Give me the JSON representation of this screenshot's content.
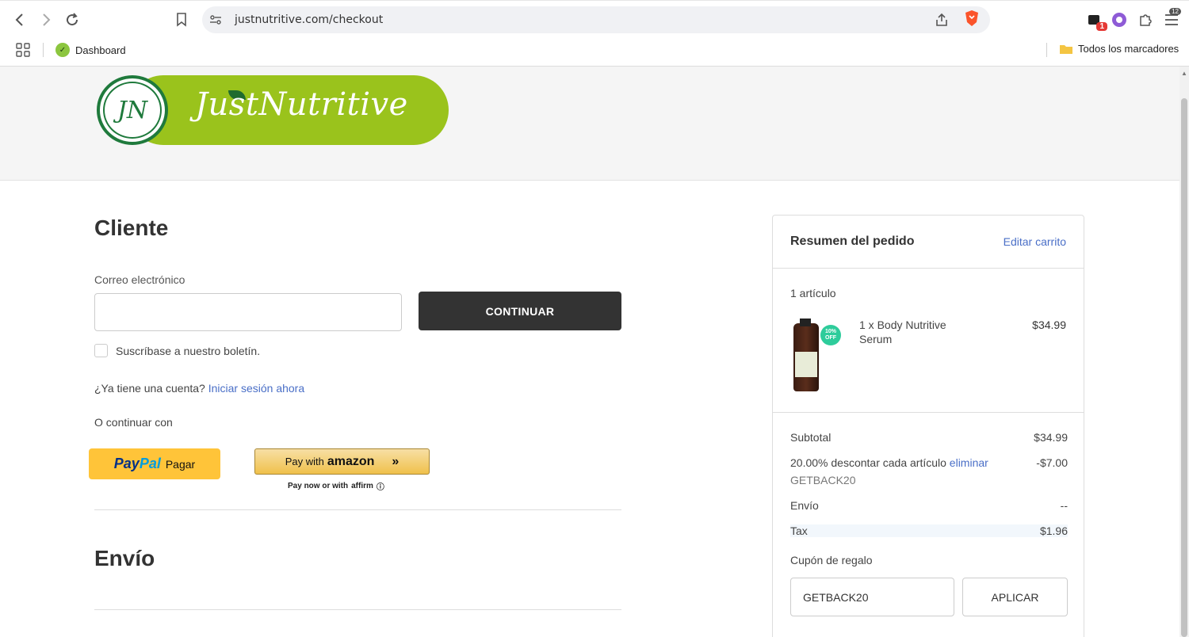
{
  "browser": {
    "url": "justnutritive.com/checkout",
    "brave_badge": "12",
    "ext_badge": "1",
    "bookmarks": {
      "dashboard": "Dashboard",
      "all": "Todos los marcadores"
    }
  },
  "header": {
    "logo_text": "JustNutritive",
    "logo_monogram": "JN"
  },
  "customer": {
    "heading": "Cliente",
    "email_label": "Correo electrónico",
    "email_value": "",
    "continue_label": "CONTINUAR",
    "newsletter_label": "Suscríbase a nuestro boletín.",
    "account_prompt": "¿Ya tiene una cuenta?",
    "sign_in_link": "Iniciar sesión ahora",
    "or_continue": "O continuar con",
    "paypal_part1": "Pay",
    "paypal_part2": "Pal",
    "paypal_action": "Pagar",
    "amazon_prefix": "Pay with",
    "amazon_brand": "amazon",
    "amazon_arrows": "»",
    "affirm_text": "Pay now or with",
    "affirm_brand": "affirm",
    "affirm_info": "ⓘ"
  },
  "shipping": {
    "heading": "Envío"
  },
  "summary": {
    "title": "Resumen del pedido",
    "edit_link": "Editar carrito",
    "item_count": "1 artículo",
    "product": {
      "name": "1 x Body Nutritive Serum",
      "price": "$34.99",
      "badge": "10% OFF"
    },
    "subtotal_label": "Subtotal",
    "subtotal_value": "$34.99",
    "discount_label": "20.00% descontar cada artículo",
    "discount_remove": "eliminar",
    "discount_value": "-$7.00",
    "discount_code": "GETBACK20",
    "shipping_label": "Envío",
    "shipping_value": "--",
    "tax_label": "Tax",
    "tax_value": "$1.96",
    "coupon_label": "Cupón de regalo",
    "coupon_value": "GETBACK20",
    "apply_label": "APLICAR"
  },
  "colors": {
    "brand_green": "#9ac31c",
    "brand_dark_green": "#1f7a3c",
    "link_blue": "#4a6fc7",
    "button_dark": "#333333",
    "paypal_yellow": "#ffc439"
  }
}
